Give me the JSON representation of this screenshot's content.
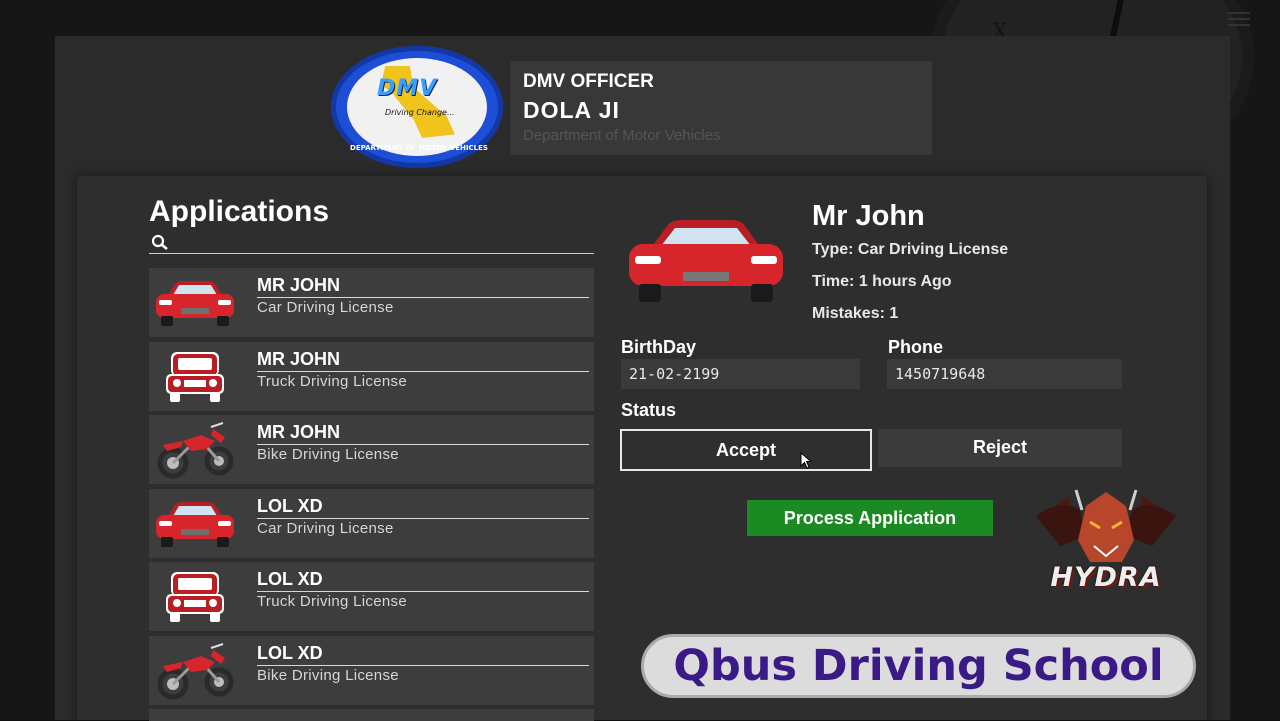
{
  "header": {
    "logo": {
      "text": "DMV",
      "slogan": "Driving Change...",
      "ring_text": "DEPARTMENT OF MOTOR VEHICLES"
    },
    "officer": {
      "role": "DMV OFFICER",
      "name": "DOLA JI",
      "department": "Department of Motor Vehicles"
    }
  },
  "applications": {
    "title": "Applications",
    "search": {
      "placeholder": "",
      "value": ""
    },
    "items": [
      {
        "name": "MR JOHN",
        "license": "Car Driving License",
        "vehicle": "car-icon"
      },
      {
        "name": "MR JOHN",
        "license": "Truck Driving License",
        "vehicle": "truck-icon"
      },
      {
        "name": "MR JOHN",
        "license": "Bike Driving License",
        "vehicle": "bike-icon"
      },
      {
        "name": "LOL XD",
        "license": "Car Driving License",
        "vehicle": "car-icon"
      },
      {
        "name": "LOL XD",
        "license": "Truck Driving License",
        "vehicle": "truck-icon"
      },
      {
        "name": "LOL XD",
        "license": "Bike Driving License",
        "vehicle": "bike-icon"
      }
    ]
  },
  "detail": {
    "name": "Mr John",
    "type": "Type: Car Driving License",
    "time": "Time: 1 hours Ago",
    "mistakes": "Mistakes: 1",
    "birthday_label": "BirthDay",
    "birthday": "21-02-2199",
    "phone_label": "Phone",
    "phone": "1450719648",
    "status_label": "Status",
    "accept_label": "Accept",
    "reject_label": "Reject",
    "selected_status": "Accept",
    "process_label": "Process Application"
  },
  "overlay": {
    "hydra_text": "HYDRA",
    "brand_text": "Qbus Driving School"
  },
  "colors": {
    "process_green": "#1b8a23",
    "vehicle_red": "#d6252b",
    "brand_purple": "#3a1a86",
    "logo_blue": "#1d4fd6"
  }
}
